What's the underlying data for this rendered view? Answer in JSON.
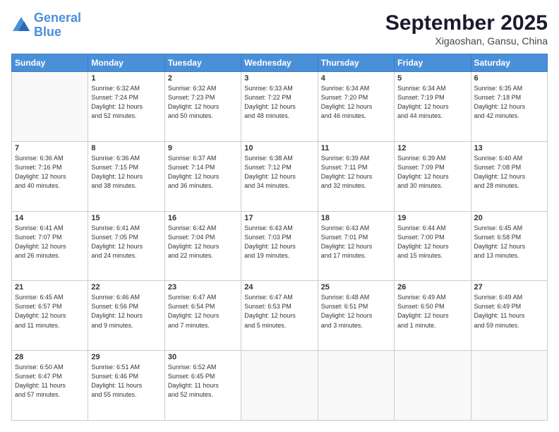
{
  "header": {
    "logo_line1": "General",
    "logo_line2": "Blue",
    "month": "September 2025",
    "location": "Xigaoshan, Gansu, China"
  },
  "days_of_week": [
    "Sunday",
    "Monday",
    "Tuesday",
    "Wednesday",
    "Thursday",
    "Friday",
    "Saturday"
  ],
  "weeks": [
    [
      {
        "day": "",
        "info": ""
      },
      {
        "day": "1",
        "info": "Sunrise: 6:32 AM\nSunset: 7:24 PM\nDaylight: 12 hours\nand 52 minutes."
      },
      {
        "day": "2",
        "info": "Sunrise: 6:32 AM\nSunset: 7:23 PM\nDaylight: 12 hours\nand 50 minutes."
      },
      {
        "day": "3",
        "info": "Sunrise: 6:33 AM\nSunset: 7:22 PM\nDaylight: 12 hours\nand 48 minutes."
      },
      {
        "day": "4",
        "info": "Sunrise: 6:34 AM\nSunset: 7:20 PM\nDaylight: 12 hours\nand 46 minutes."
      },
      {
        "day": "5",
        "info": "Sunrise: 6:34 AM\nSunset: 7:19 PM\nDaylight: 12 hours\nand 44 minutes."
      },
      {
        "day": "6",
        "info": "Sunrise: 6:35 AM\nSunset: 7:18 PM\nDaylight: 12 hours\nand 42 minutes."
      }
    ],
    [
      {
        "day": "7",
        "info": "Sunrise: 6:36 AM\nSunset: 7:16 PM\nDaylight: 12 hours\nand 40 minutes."
      },
      {
        "day": "8",
        "info": "Sunrise: 6:36 AM\nSunset: 7:15 PM\nDaylight: 12 hours\nand 38 minutes."
      },
      {
        "day": "9",
        "info": "Sunrise: 6:37 AM\nSunset: 7:14 PM\nDaylight: 12 hours\nand 36 minutes."
      },
      {
        "day": "10",
        "info": "Sunrise: 6:38 AM\nSunset: 7:12 PM\nDaylight: 12 hours\nand 34 minutes."
      },
      {
        "day": "11",
        "info": "Sunrise: 6:39 AM\nSunset: 7:11 PM\nDaylight: 12 hours\nand 32 minutes."
      },
      {
        "day": "12",
        "info": "Sunrise: 6:39 AM\nSunset: 7:09 PM\nDaylight: 12 hours\nand 30 minutes."
      },
      {
        "day": "13",
        "info": "Sunrise: 6:40 AM\nSunset: 7:08 PM\nDaylight: 12 hours\nand 28 minutes."
      }
    ],
    [
      {
        "day": "14",
        "info": "Sunrise: 6:41 AM\nSunset: 7:07 PM\nDaylight: 12 hours\nand 26 minutes."
      },
      {
        "day": "15",
        "info": "Sunrise: 6:41 AM\nSunset: 7:05 PM\nDaylight: 12 hours\nand 24 minutes."
      },
      {
        "day": "16",
        "info": "Sunrise: 6:42 AM\nSunset: 7:04 PM\nDaylight: 12 hours\nand 22 minutes."
      },
      {
        "day": "17",
        "info": "Sunrise: 6:43 AM\nSunset: 7:03 PM\nDaylight: 12 hours\nand 19 minutes."
      },
      {
        "day": "18",
        "info": "Sunrise: 6:43 AM\nSunset: 7:01 PM\nDaylight: 12 hours\nand 17 minutes."
      },
      {
        "day": "19",
        "info": "Sunrise: 6:44 AM\nSunset: 7:00 PM\nDaylight: 12 hours\nand 15 minutes."
      },
      {
        "day": "20",
        "info": "Sunrise: 6:45 AM\nSunset: 6:58 PM\nDaylight: 12 hours\nand 13 minutes."
      }
    ],
    [
      {
        "day": "21",
        "info": "Sunrise: 6:45 AM\nSunset: 6:57 PM\nDaylight: 12 hours\nand 11 minutes."
      },
      {
        "day": "22",
        "info": "Sunrise: 6:46 AM\nSunset: 6:56 PM\nDaylight: 12 hours\nand 9 minutes."
      },
      {
        "day": "23",
        "info": "Sunrise: 6:47 AM\nSunset: 6:54 PM\nDaylight: 12 hours\nand 7 minutes."
      },
      {
        "day": "24",
        "info": "Sunrise: 6:47 AM\nSunset: 6:53 PM\nDaylight: 12 hours\nand 5 minutes."
      },
      {
        "day": "25",
        "info": "Sunrise: 6:48 AM\nSunset: 6:51 PM\nDaylight: 12 hours\nand 3 minutes."
      },
      {
        "day": "26",
        "info": "Sunrise: 6:49 AM\nSunset: 6:50 PM\nDaylight: 12 hours\nand 1 minute."
      },
      {
        "day": "27",
        "info": "Sunrise: 6:49 AM\nSunset: 6:49 PM\nDaylight: 11 hours\nand 59 minutes."
      }
    ],
    [
      {
        "day": "28",
        "info": "Sunrise: 6:50 AM\nSunset: 6:47 PM\nDaylight: 11 hours\nand 57 minutes."
      },
      {
        "day": "29",
        "info": "Sunrise: 6:51 AM\nSunset: 6:46 PM\nDaylight: 11 hours\nand 55 minutes."
      },
      {
        "day": "30",
        "info": "Sunrise: 6:52 AM\nSunset: 6:45 PM\nDaylight: 11 hours\nand 52 minutes."
      },
      {
        "day": "",
        "info": ""
      },
      {
        "day": "",
        "info": ""
      },
      {
        "day": "",
        "info": ""
      },
      {
        "day": "",
        "info": ""
      }
    ]
  ]
}
